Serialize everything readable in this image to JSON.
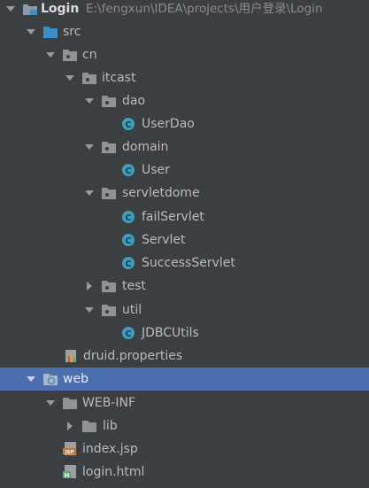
{
  "project": {
    "name": "Login",
    "path": "E:\\fengxun\\IDEA\\projects\\用户登录\\Login"
  },
  "nodes": [
    {
      "label": "src",
      "icon": "source-folder-icon"
    },
    {
      "label": "cn",
      "icon": "package-icon"
    },
    {
      "label": "itcast",
      "icon": "package-icon"
    },
    {
      "label": "dao",
      "icon": "package-icon"
    },
    {
      "label": "UserDao",
      "icon": "java-class-icon"
    },
    {
      "label": "domain",
      "icon": "package-icon"
    },
    {
      "label": "User",
      "icon": "java-class-icon"
    },
    {
      "label": "servletdome",
      "icon": "package-icon"
    },
    {
      "label": "failServlet",
      "icon": "java-class-icon"
    },
    {
      "label": "Servlet",
      "icon": "java-class-icon"
    },
    {
      "label": "SuccessServlet",
      "icon": "java-class-icon"
    },
    {
      "label": "test",
      "icon": "package-icon"
    },
    {
      "label": "util",
      "icon": "package-icon"
    },
    {
      "label": "JDBCUtils",
      "icon": "java-class-icon"
    },
    {
      "label": "druid.properties",
      "icon": "properties-file-icon"
    },
    {
      "label": "web",
      "icon": "web-folder-icon"
    },
    {
      "label": "WEB-INF",
      "icon": "folder-icon"
    },
    {
      "label": "lib",
      "icon": "folder-icon"
    },
    {
      "label": "index.jsp",
      "icon": "jsp-file-icon"
    },
    {
      "label": "login.html",
      "icon": "html-file-icon"
    }
  ],
  "colors": {
    "background": "#3c3f41",
    "selection": "#4b6eaf",
    "text": "#bbbbbb",
    "class_icon": "#3f9ebd",
    "source_folder": "#3d8ec6"
  }
}
